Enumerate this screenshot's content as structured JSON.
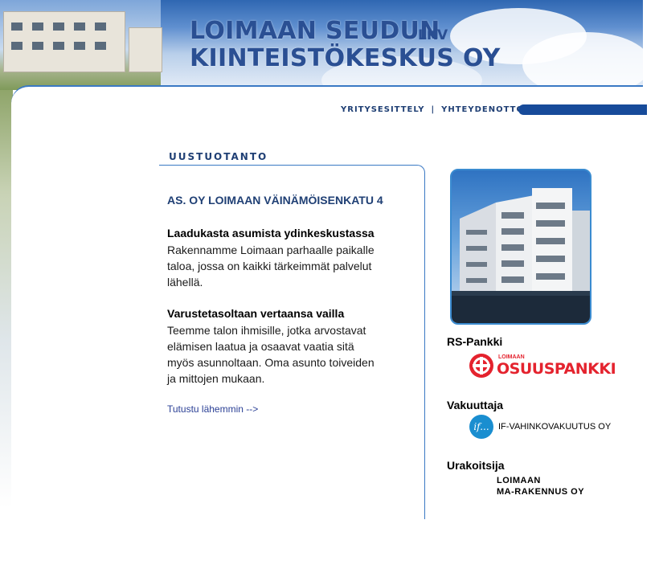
{
  "header": {
    "company_line1": "LOIMAAN SEUDUN",
    "company_line2": "KIINTEISTÖKESKUS OY",
    "lkv": "LKV"
  },
  "nav": {
    "items": [
      "YRITYSESITTELY",
      "YHTEYDENOTTO"
    ],
    "separator": "|"
  },
  "main": {
    "section_title": "UUSTUOTANTO",
    "headline": "AS. OY LOIMAAN VÄINÄMÖISENKATU 4",
    "block1_title": "Laadukasta asumista ydinkeskustassa",
    "block1_text": "Rakennamme Loimaan parhaalle paikalle taloa, jossa on kaikki tärkeimmät palvelut lähellä.",
    "block2_title": "Varustetasoltaan vertaansa vailla",
    "block2_text": "Teemme talon ihmisille, jotka arvostavat elämisen laatua ja osaavat vaatia sitä myös asunnoltaan. Oma asunto toiveiden ja mittojen mukaan.",
    "more_link": "Tutustu lähemmin -->"
  },
  "sidebar": {
    "bank_label": "RS-Pankki",
    "bank_logo_small": "LOIMAAN",
    "bank_logo_big": "OSUUSPANKKI",
    "insurer_label": "Vakuuttaja",
    "insurer_logo_mark": "if...",
    "insurer_name": "IF-VAHINKOVAKUUTUS OY",
    "contractor_label": "Urakoitsija",
    "contractor_line1": "LOIMAAN",
    "contractor_line2": "MA-RAKENNUS OY"
  },
  "colors": {
    "brand_blue": "#1f3f74",
    "accent_blue": "#3a79c4",
    "bank_red": "#e4232e",
    "if_blue": "#1a8ed0"
  }
}
